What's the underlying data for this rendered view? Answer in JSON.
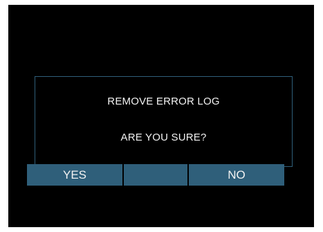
{
  "dialog": {
    "title": "REMOVE ERROR LOG",
    "message": "ARE YOU SURE?"
  },
  "buttons": {
    "yes_label": "YES",
    "middle_label": "",
    "no_label": "NO"
  },
  "colors": {
    "screen_background": "#000000",
    "accent": "#2f5f7a",
    "text": "#f2f2f2"
  }
}
